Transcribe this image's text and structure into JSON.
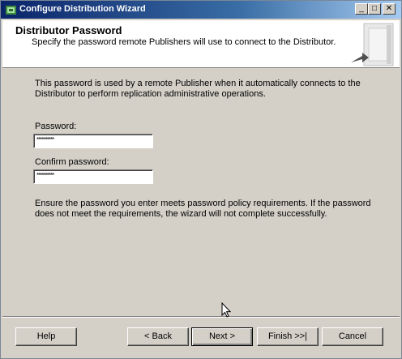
{
  "window": {
    "title": "Configure Distribution Wizard"
  },
  "titlebar_buttons": {
    "minimize": "_",
    "maximize": "□",
    "close": "✕"
  },
  "header": {
    "title": "Distributor Password",
    "subtitle": "Specify the password remote Publishers will use to connect to the Distributor."
  },
  "content": {
    "intro": "This password is used by a remote Publisher when it automatically connects to the Distributor to perform replication administrative operations.",
    "password_label": "Password:",
    "password_value": "**********",
    "confirm_label": "Confirm password:",
    "confirm_value": "**********",
    "note": "Ensure the password you enter meets password policy requirements. If the password does not meet the requirements, the wizard will not complete successfully."
  },
  "buttons": {
    "help": "Help",
    "back": "< Back",
    "next": "Next >",
    "finish": "Finish >>|",
    "cancel": "Cancel"
  },
  "icons": {
    "app": "wizard-app-icon",
    "header_graphic": "server-icon",
    "cursor": "mouse-pointer-icon"
  }
}
